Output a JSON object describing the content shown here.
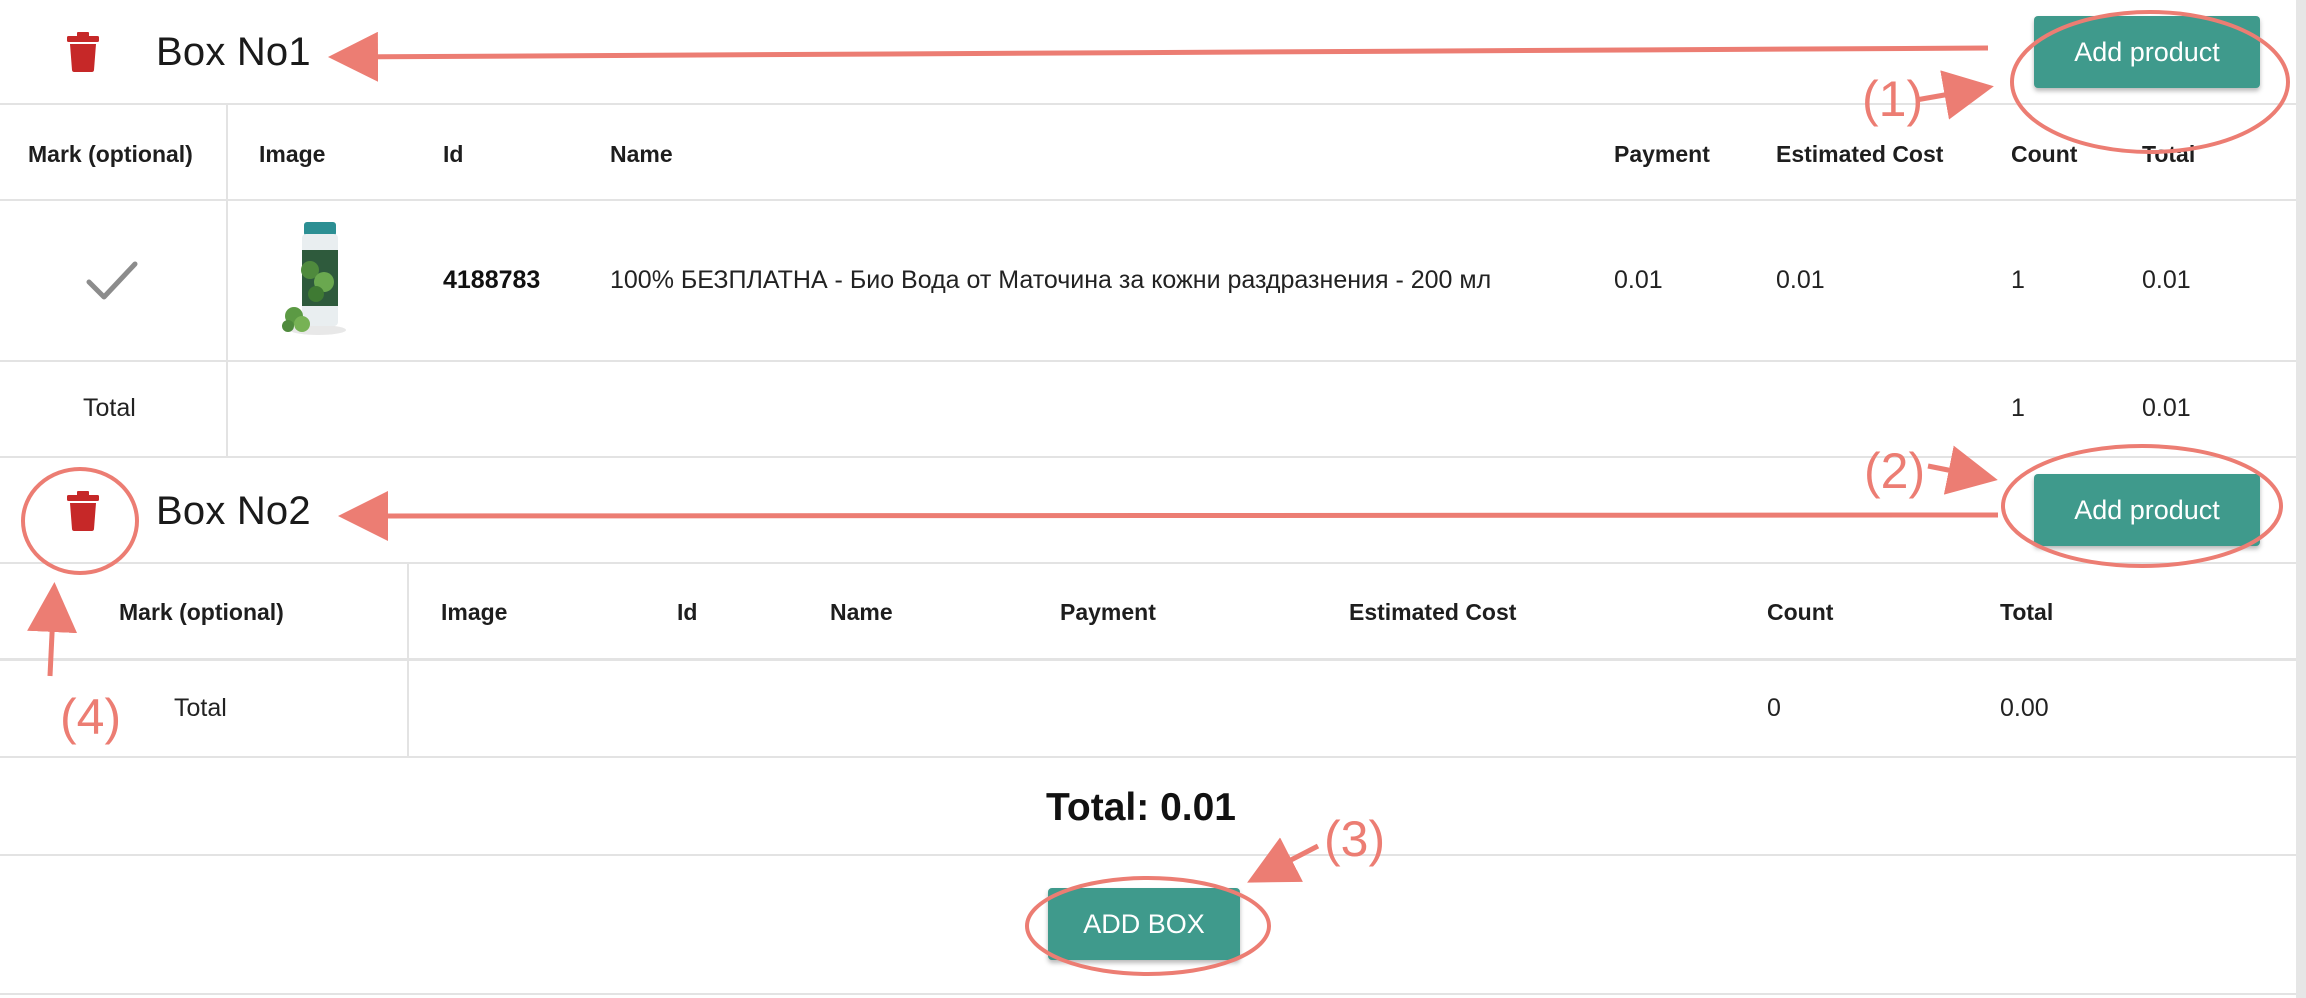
{
  "box1": {
    "title": "Box No1",
    "add_label": "Add product",
    "headers": [
      "Mark (optional)",
      "Image",
      "Id",
      "Name",
      "Payment",
      "Estimated Cost",
      "Count",
      "Total"
    ],
    "rows": [
      {
        "id": "4188783",
        "name": "100% БЕЗПЛАТНА - Био Вода от Маточина за кожни раздразнения - 200 мл",
        "payment": "0.01",
        "estimated_cost": "0.01",
        "count": "1",
        "total": "0.01"
      }
    ],
    "total_label": "Total",
    "total_count": "1",
    "total_sum": "0.01"
  },
  "box2": {
    "title": "Box No2",
    "add_label": "Add product",
    "headers": [
      "Mark (optional)",
      "Image",
      "Id",
      "Name",
      "Payment",
      "Estimated Cost",
      "Count",
      "Total"
    ],
    "total_label": "Total",
    "total_count": "0",
    "total_sum": "0.00"
  },
  "grand_total": "Total: 0.01",
  "add_box_label": "ADD BOX",
  "annotations": {
    "c1": "(1)",
    "c2": "(2)",
    "c3": "(3)",
    "c4": "(4)"
  },
  "colors": {
    "accent": "#3f9a8c",
    "delete": "#c62828",
    "annotation": "#ec7d73",
    "check": "#8c8c8c"
  },
  "icons": {
    "delete": "trash-icon",
    "mark": "checkmark-icon"
  }
}
